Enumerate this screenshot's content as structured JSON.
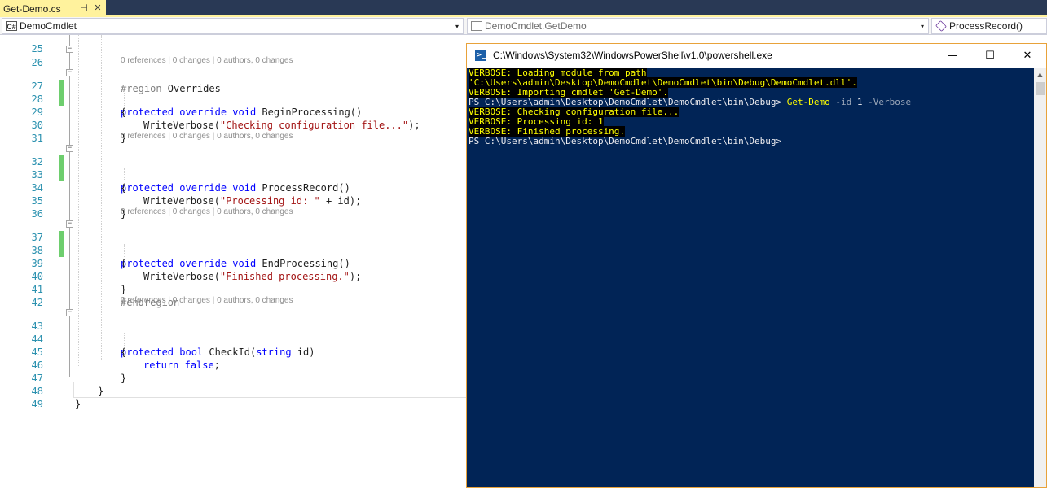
{
  "tab": {
    "title": "Get-Demo.cs",
    "pin_glyph": "⊣",
    "close_glyph": "✕"
  },
  "navbar": {
    "project": {
      "icon_text": "C#",
      "label": "DemoCmdlet"
    },
    "type": {
      "label": "DemoCmdlet.GetDemo"
    },
    "member": {
      "label": "ProcessRecord()"
    },
    "dropdown_glyph": "▾"
  },
  "editor": {
    "line_numbers": {
      "l25": "25",
      "l26": "26",
      "l27": "27",
      "l28": "28",
      "l29": "29",
      "l30": "30",
      "l31": "31",
      "l32": "32",
      "l33": "33",
      "l34": "34",
      "l35": "35",
      "l36": "36",
      "l37": "37",
      "l38": "38",
      "l39": "39",
      "l40": "40",
      "l41": "41",
      "l42": "42",
      "l43": "43",
      "l44": "44",
      "l45": "45",
      "l46": "46",
      "l47": "47",
      "l48": "48",
      "l49": "49"
    },
    "code": {
      "region_kw": "#region",
      "region_name": " Overrides",
      "endregion": "#endregion",
      "protected": "protected",
      "override": "override",
      "void": "void",
      "bool": "bool",
      "string": "string",
      "return": "return",
      "false": "false",
      "open_brace": "{",
      "close_brace": "}",
      "begin_sig": " BeginProcessing()",
      "process_sig": " ProcessRecord()",
      "end_sig": " EndProcessing()",
      "checkid_name": " CheckId(",
      "checkid_param": " id)",
      "write_verbose": "WriteVerbose(",
      "str_checking": "\"Checking configuration file...\"",
      "str_processing": "\"Processing id: \"",
      "concat_id": " + id",
      "str_finished": "\"Finished processing.\"",
      "call_end": ");",
      "semicolon": ";"
    },
    "codelens": {
      "references": "0 references",
      "changes": "0 changes",
      "authors": "0 authors, 0 changes",
      "sep": " | "
    }
  },
  "powershell": {
    "title": "C:\\Windows\\System32\\WindowsPowerShell\\v1.0\\powershell.exe",
    "icon_text": ">_",
    "minimize_glyph": "—",
    "maximize_glyph": "☐",
    "close_glyph": "✕",
    "lines": {
      "v1": "VERBOSE: Loading module from path",
      "v2": "'C:\\Users\\admin\\Desktop\\DemoCmdlet\\DemoCmdlet\\bin\\Debug\\DemoCmdlet.dll'.",
      "v3": "VERBOSE: Importing cmdlet 'Get-Demo'.",
      "p1_prompt": "PS C:\\Users\\admin\\Desktop\\DemoCmdlet\\DemoCmdlet\\bin\\Debug> ",
      "p1_cmd": "Get-Demo",
      "p1_param1": " -id",
      "p1_val": " 1",
      "p1_param2": " -Verbose",
      "v4": "VERBOSE: Checking configuration file...",
      "v5": "VERBOSE: Processing id: 1",
      "v6": "VERBOSE: Finished processing.",
      "p2_prompt": "PS C:\\Users\\admin\\Desktop\\DemoCmdlet\\DemoCmdlet\\bin\\Debug>"
    },
    "scroll_up_glyph": "▲"
  },
  "colors": {
    "tab_active": "#fff29d",
    "titlebar_bg": "#293955",
    "ps_bg": "#012456",
    "ps_verbose": "#ffff00",
    "window_border": "#e8a23a",
    "change_bar": "#6ece6e",
    "keyword": "#0000ff",
    "string": "#a31515",
    "line_number": "#2b91af"
  }
}
